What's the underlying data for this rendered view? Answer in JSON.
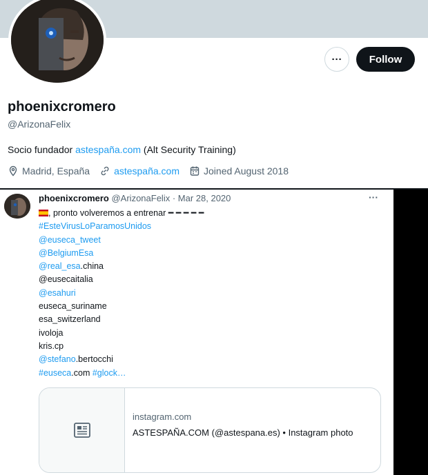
{
  "profile": {
    "display_name": "phoenixcromero",
    "handle": "@ArizonaFelix",
    "follow_label": "Follow",
    "more_label": "···",
    "bio_prefix": "Socio fundador ",
    "bio_link": "astespaña.com",
    "bio_suffix": " (Alt Security Training)",
    "location": "Madrid, España",
    "website": "astespaña.com",
    "joined": "Joined August 2018"
  },
  "tweet": {
    "author_name": "phoenixcromero",
    "author_handle": "@ArizonaFelix",
    "separator": " · ",
    "date": "Mar 28, 2020",
    "more_label": "···",
    "line1": ", pronto volveremos a entrenar ━ ━ ━ ━ ━",
    "hashtag1": "#EsteVirusLoParamosUnidos",
    "mention1": "@euseca_tweet",
    "mention2": "@BelgiumEsa",
    "mention3": "@real_esa",
    "mention3_suffix": ".china",
    "plain1": "@eusecaitalia",
    "mention4": "@esahuri",
    "plain2": "euseca_suriname",
    "plain3": "esa_switzerland",
    "plain4": "ivoloja",
    "plain5": "kris.cp",
    "mention5": "@stefano",
    "mention5_suffix": ".bertocchi",
    "hashtag2": "#euseca",
    "hashtag2_suffix": ".com ",
    "hashtag3": "#glock…"
  },
  "card": {
    "domain": "instagram.com",
    "title": "ASTESPAÑA.COM (@astespana.es) • Instagram photo",
    "icon": "article-icon"
  },
  "colors": {
    "link": "#1d9bf0",
    "banner": "#cfd9de",
    "follow_bg": "#0f1419",
    "muted": "#536471"
  }
}
